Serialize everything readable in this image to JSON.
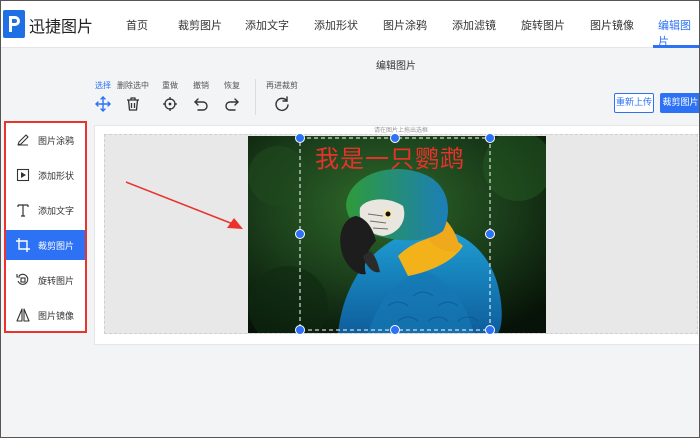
{
  "app": {
    "brand": "迅捷图片",
    "logo_icon": "logo-p-icon"
  },
  "nav": {
    "items": [
      {
        "label": "首页"
      },
      {
        "label": "裁剪图片"
      },
      {
        "label": "添加文字"
      },
      {
        "label": "添加形状"
      },
      {
        "label": "图片涂鸦"
      },
      {
        "label": "添加滤镜"
      },
      {
        "label": "旋转图片"
      },
      {
        "label": "图片镜像"
      },
      {
        "label": "编辑图片"
      }
    ],
    "active_index": 8
  },
  "editor": {
    "title": "编辑图片",
    "tools": [
      {
        "label": "选择",
        "icon": "move-icon"
      },
      {
        "label": "删除选中",
        "icon": "trash-icon"
      },
      {
        "label": "重做",
        "icon": "target-icon"
      },
      {
        "label": "撤销",
        "icon": "undo-icon"
      },
      {
        "label": "恢复",
        "icon": "redo-icon"
      },
      {
        "label": "再进裁剪",
        "icon": "refresh-icon"
      }
    ],
    "reupload_label": "重新上传",
    "crop_label": "裁剪图片",
    "hint": "请在图片上拖出选框"
  },
  "sidebar": {
    "items": [
      {
        "label": "图片涂鸦",
        "icon": "pen-icon"
      },
      {
        "label": "添加形状",
        "icon": "shape-icon"
      },
      {
        "label": "添加文字",
        "icon": "text-icon"
      },
      {
        "label": "裁剪图片",
        "icon": "crop-icon"
      },
      {
        "label": "旋转图片",
        "icon": "rotate-icon"
      },
      {
        "label": "图片镜像",
        "icon": "mirror-icon"
      }
    ],
    "active_index": 3
  },
  "image": {
    "caption": "我是一只鹦鹉",
    "subject": "parrot-photo"
  },
  "colors": {
    "accent": "#2d72f5",
    "highlight": "#e8332f",
    "caption": "#e5332b"
  }
}
